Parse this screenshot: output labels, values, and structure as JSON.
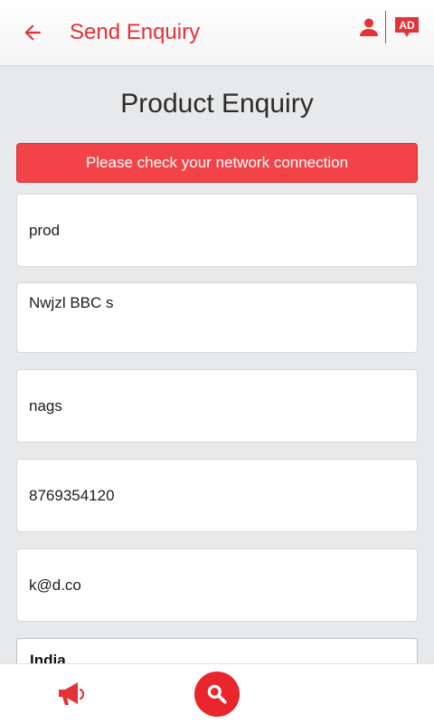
{
  "header": {
    "title": "Send Enquiry",
    "back_icon": "arrow-left-icon",
    "user_icon": "user-icon",
    "ad_icon": "ad-chat-icon",
    "ad_label": "AD"
  },
  "page": {
    "title": "Product Enquiry",
    "error_message": "Please check your network connection"
  },
  "form": {
    "product": "prod",
    "message": "Nwjzl BBC s",
    "name": "nags",
    "phone": "8769354120",
    "email": "k@d.co",
    "country": "India"
  },
  "bottom_bar": {
    "left_icon": "megaphone-icon",
    "center_icon": "search-icon"
  },
  "colors": {
    "accent": "#e53238",
    "error_bg": "#f24448",
    "background": "#e8e9eb",
    "fab": "#e8262c"
  }
}
